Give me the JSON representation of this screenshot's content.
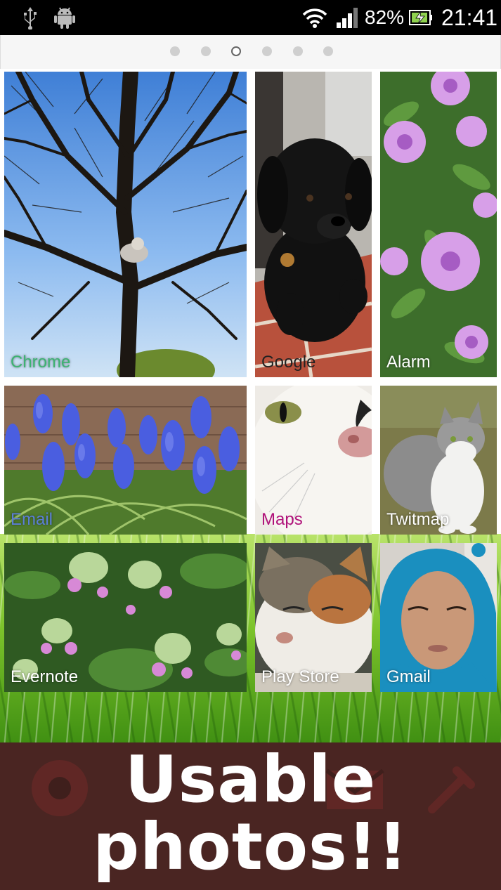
{
  "status_bar": {
    "battery_percent": "82%",
    "time": "21:41",
    "icons": [
      "usb-icon",
      "android-icon",
      "wifi-icon",
      "signal-icon",
      "battery-charging-icon"
    ]
  },
  "pager": {
    "page_count": 6,
    "active_index": 2
  },
  "tiles": [
    {
      "label": "Chrome",
      "label_color": "#3cb371",
      "photo": "bare tree against blue sky with cat"
    },
    {
      "label": "Google",
      "label_color": "#222222",
      "photo": "black puppy on brick step"
    },
    {
      "label": "Alarm",
      "label_color": "#ffffff",
      "photo": "pink bee balm flowers"
    },
    {
      "label": "Email",
      "label_color": "#5b7fd6",
      "photo": "blue grape hyacinths"
    },
    {
      "label": "Maps",
      "label_color": "#b0127a",
      "photo": "close-up white cat face"
    },
    {
      "label": "Twitmap",
      "label_color": "#ffffff",
      "photo": "grey and white cat sitting on grass"
    },
    {
      "label": "Evernote",
      "label_color": "#ffffff",
      "photo": "pink oregano flowers"
    },
    {
      "label": "Play Store",
      "label_color": "#ffffff",
      "photo": "calico cat squinting"
    },
    {
      "label": "Gmail",
      "label_color": "#ffffff",
      "photo": "woman in blue hood"
    }
  ],
  "banner": {
    "line1": "Usable",
    "line2": "photos!!",
    "background": "#4a2522"
  }
}
